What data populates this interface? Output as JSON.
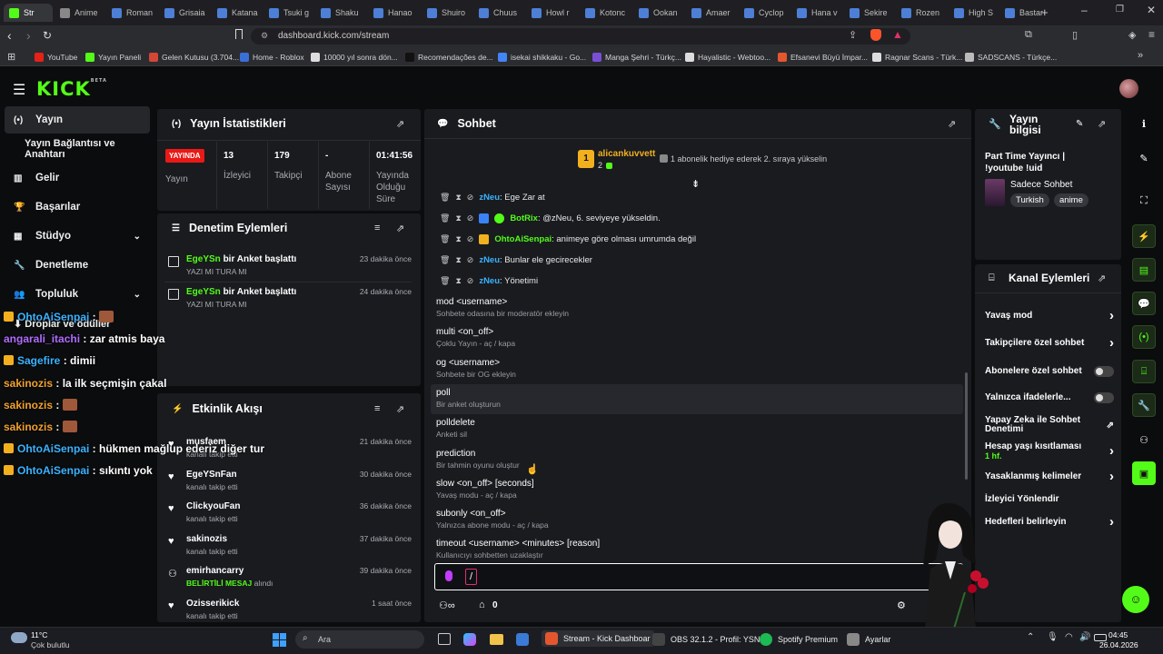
{
  "browser": {
    "tabs": [
      {
        "label": "Str",
        "color": "#53fc18"
      },
      {
        "label": "Anime",
        "color": "#888"
      },
      {
        "label": "Roman",
        "color": "#4d7fd6"
      },
      {
        "label": "Grisaia",
        "color": "#4d7fd6"
      },
      {
        "label": "Katana",
        "color": "#4d7fd6"
      },
      {
        "label": "Tsuki g",
        "color": "#4d7fd6"
      },
      {
        "label": "Shaku",
        "color": "#4d7fd6"
      },
      {
        "label": "Hanao",
        "color": "#4d7fd6"
      },
      {
        "label": "Shuiro",
        "color": "#4d7fd6"
      },
      {
        "label": "Chuus",
        "color": "#4d7fd6"
      },
      {
        "label": "Howl r",
        "color": "#4d7fd6"
      },
      {
        "label": "Kotonc",
        "color": "#4d7fd6"
      },
      {
        "label": "Ookan",
        "color": "#4d7fd6"
      },
      {
        "label": "Amaer",
        "color": "#4d7fd6"
      },
      {
        "label": "Cyclop",
        "color": "#4d7fd6"
      },
      {
        "label": "Hana v",
        "color": "#4d7fd6"
      },
      {
        "label": "Sekire",
        "color": "#4d7fd6"
      },
      {
        "label": "Rozen",
        "color": "#4d7fd6"
      },
      {
        "label": "High S",
        "color": "#4d7fd6"
      },
      {
        "label": "Bastar",
        "color": "#4d7fd6"
      }
    ],
    "url": "dashboard.kick.com/stream",
    "bookmarks": [
      {
        "label": "YouTube",
        "color": "#e62117"
      },
      {
        "label": "Yayın Paneli",
        "color": "#53fc18"
      },
      {
        "label": "Gelen Kutusu (3.704...",
        "color": "#d44638"
      },
      {
        "label": "Home - Roblox",
        "color": "#3a6fd8"
      },
      {
        "label": "10000 yıl sonra dön...",
        "color": "#dddddd"
      },
      {
        "label": "Recomendações de...",
        "color": "#111111"
      },
      {
        "label": "isekai shikkaku - Go...",
        "color": "#4285f4"
      },
      {
        "label": "Manga Şehri - Türkç...",
        "color": "#7a4fd6"
      },
      {
        "label": "Hayalistic - Webtoo...",
        "color": "#dddddd"
      },
      {
        "label": "Efsanevi Büyü İmpar...",
        "color": "#e4572e"
      },
      {
        "label": "Ragnar Scans - Türk...",
        "color": "#dddddd"
      },
      {
        "label": "SADSCANS - Türkçe...",
        "color": "#bbbbbb"
      }
    ]
  },
  "kick": {
    "logo": "KICK",
    "logo_sup": "BETA"
  },
  "nav": [
    {
      "label": "Yayın",
      "icon": "(•)"
    },
    {
      "label": "Yayın Bağlantısı ve Anahtarı",
      "icon": ""
    },
    {
      "label": "Gelir",
      "icon": "▥"
    },
    {
      "label": "Başarılar",
      "icon": "🏆"
    },
    {
      "label": "Stüdyo",
      "icon": "▦"
    },
    {
      "label": "Denetleme",
      "icon": "🔧"
    },
    {
      "label": "Topluluk",
      "icon": "👥"
    }
  ],
  "stats": {
    "title": "Yayın İstatistikleri",
    "live_badge": "YAYINDA",
    "cols": [
      {
        "value": "",
        "label": "Yayın"
      },
      {
        "value": "13",
        "label": "İzleyici"
      },
      {
        "value": "179",
        "label": "Takipçi"
      },
      {
        "value": "-",
        "label": "Abone Sayısı"
      },
      {
        "value": "01:41:56",
        "label": "Yayında Olduğu Süre"
      }
    ]
  },
  "moderation": {
    "title": "Denetim Eylemleri",
    "items": [
      {
        "user": "EgeYSn",
        "text": " bir Anket başlattı",
        "sub": "YAZI MI TURA MI",
        "time": "23 dakika önce"
      },
      {
        "user": "EgeYSn",
        "text": " bir Anket başlattı",
        "sub": "YAZI MI TURA MI",
        "time": "24 dakika önce"
      }
    ]
  },
  "activity": {
    "title": "Etkinlik Akışı",
    "items": [
      {
        "user": "musfaem",
        "sub": "kanalı takip etti",
        "highlight": "",
        "time": "21 dakika önce"
      },
      {
        "user": "EgeYSnFan",
        "sub": "kanalı takip etti",
        "highlight": "",
        "time": "30 dakika önce"
      },
      {
        "user": "ClickyouFan",
        "sub": "kanalı takip etti",
        "highlight": "",
        "time": "36 dakika önce"
      },
      {
        "user": "sakinozis",
        "sub": "kanalı takip etti",
        "highlight": "",
        "time": "37 dakika önce"
      },
      {
        "user": "emirhancarry",
        "sub": " alındı",
        "highlight": "BELİRTİLİ MESAJ",
        "time": "39 dakika önce"
      },
      {
        "user": "Ozisserikick",
        "sub": "kanalı takip etti",
        "highlight": "",
        "time": "1 saat önce"
      }
    ]
  },
  "chat": {
    "title": "Sohbet",
    "pinned_user": "alicankuvvett",
    "pinned_count": "2",
    "pinned_text": "1 abonelik hediye ederek 2. sıraya yükselin",
    "messages": [
      {
        "user": "zNeu",
        "color": "#3bb3ff",
        "text": ": Ege Zar at"
      },
      {
        "user": "BotRix",
        "color": "#53fc18",
        "text": ": @zNeu, 6. seviyeye yükseldin."
      },
      {
        "user": "OhtoAiSenpai",
        "color": "#53fc18",
        "text": ": animeye göre olması umrumda değil"
      },
      {
        "user": "zNeu",
        "color": "#3bb3ff",
        "text": ": Bunlar ele gecirecekler"
      },
      {
        "user": "zNeu",
        "color": "#3bb3ff",
        "text": ": Yönetimi"
      }
    ],
    "commands": [
      {
        "cmd": "mod <username>",
        "desc": "Sohbete odasına bir moderatör ekleyin"
      },
      {
        "cmd": "multi <on_off>",
        "desc": "Çoklu Yayın - aç / kapa"
      },
      {
        "cmd": "og <username>",
        "desc": "Sohbete bir OG ekleyin"
      },
      {
        "cmd": "poll",
        "desc": "Bir anket oluşturun"
      },
      {
        "cmd": "polldelete",
        "desc": "Anketi sil"
      },
      {
        "cmd": "prediction",
        "desc": "Bir tahmin oyunu oluştur"
      },
      {
        "cmd": "slow <on_off> [seconds]",
        "desc": "Yavaş modu - aç / kapa"
      },
      {
        "cmd": "subonly <on_off>",
        "desc": "Yalnızca abone modu - aç / kapa"
      },
      {
        "cmd": "timeout <username> <minutes> [reason]",
        "desc": "Kullanıcıyı sohbetten uzaklaştır"
      }
    ],
    "input_value": "/",
    "footer_count": "0"
  },
  "stream_info": {
    "title": "Yayın bilgisi",
    "stream_title": "Part Time Yayıncı | !youtube !uid",
    "category": "Sadece Sohbet",
    "tags": [
      "Turkish",
      "anime"
    ]
  },
  "channel_actions": {
    "title": "Kanal Eylemleri",
    "items": [
      {
        "label": "Yavaş mod",
        "kind": "chev",
        "sub": ""
      },
      {
        "label": "Takipçilere özel sohbet",
        "kind": "chev",
        "sub": ""
      },
      {
        "label": "Abonelere özel sohbet",
        "kind": "toggle",
        "sub": ""
      },
      {
        "label": "Yalnızca ifadelerle...",
        "kind": "toggle",
        "sub": ""
      },
      {
        "label": "Yapay Zeka ile Sohbet Denetimi",
        "kind": "ext",
        "sub": ""
      },
      {
        "label": "Hesap yaşı kısıtlaması",
        "kind": "chev",
        "sub": "1 hf."
      },
      {
        "label": "Yasaklanmış kelimeler",
        "kind": "chev",
        "sub": ""
      },
      {
        "label": "İzleyici Yönlendir",
        "kind": "none",
        "sub": ""
      },
      {
        "label": "Hedefleri belirleyin",
        "kind": "chev",
        "sub": ""
      }
    ]
  },
  "overlay_chat": [
    {
      "user": "OhtoAiSenpai",
      "color": "#3bb3ff",
      "text": " : ",
      "badge": true
    },
    {
      "user": "angarali_itachi",
      "color": "#b06cff",
      "text": " : zar atmis baya",
      "badge": false
    },
    {
      "user": "Sagefire",
      "color": "#3bb3ff",
      "text": " : dimii",
      "badge": true
    },
    {
      "user": "sakinozis",
      "color": "#f0a030",
      "text": " : la ilk seçmişin çakal",
      "badge": false
    },
    {
      "user": "sakinozis",
      "color": "#f0a030",
      "text": " : ",
      "badge": false
    },
    {
      "user": "sakinozis",
      "color": "#f0a030",
      "text": " : ",
      "badge": false
    },
    {
      "user": "OhtoAiSenpai",
      "color": "#3bb3ff",
      "text": " : hükmen mağlup ederiz diğer tur",
      "badge": true
    },
    {
      "user": "OhtoAiSenpai",
      "color": "#3bb3ff",
      "text": " : sıkıntı yok",
      "badge": true
    }
  ],
  "nav_extra": "Droplar ve ödüller",
  "taskbar": {
    "weather_temp": "11°C",
    "weather_desc": "Çok bulutlu",
    "search": "Ara",
    "apps": [
      {
        "label": "Stream - Kick Dashboar",
        "color": "#e4572e"
      },
      {
        "label": "OBS 32.1.2 - Profil: YSN",
        "color": "#444"
      },
      {
        "label": "Spotify Premium",
        "color": "#1db954"
      },
      {
        "label": "Ayarlar",
        "color": "#888"
      }
    ],
    "time": "04:45",
    "date": "26.04.2026"
  }
}
